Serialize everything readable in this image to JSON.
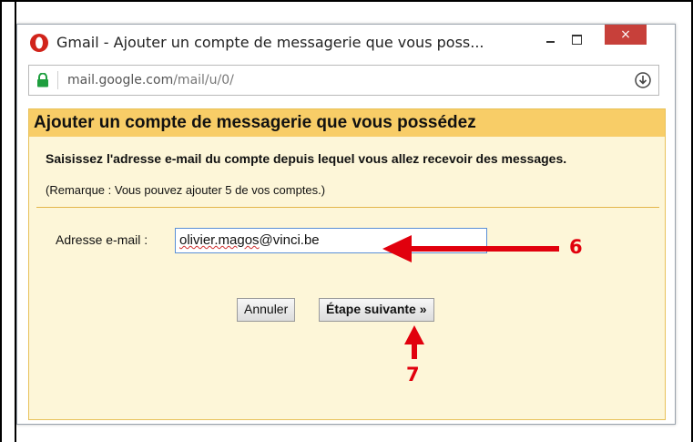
{
  "window": {
    "title": "Gmail - Ajouter un compte de messagerie que vous poss...",
    "close_glyph": "×"
  },
  "addressbar": {
    "url_host": "mail.google.com",
    "url_path": "/mail/u/0/"
  },
  "dialog": {
    "title": "Ajouter un compte de messagerie que vous possédez",
    "instruction": "Saisissez l'adresse e-mail du compte depuis lequel vous allez recevoir des messages.",
    "note": "(Remarque : Vous pouvez ajouter 5 de vos comptes.)",
    "email_label": "Adresse e-mail :",
    "email_value_misspelled": "olivier.magos",
    "email_value_rest": "@vinci.be",
    "cancel_label": "Annuler",
    "next_label": "Étape suivante »"
  },
  "annotations": {
    "step6": "6",
    "step7": "7",
    "color": "#e1000d"
  },
  "colors": {
    "dialog_header": "#f8cd67",
    "dialog_body": "#fdf6d8",
    "close_button": "#c7403a"
  }
}
